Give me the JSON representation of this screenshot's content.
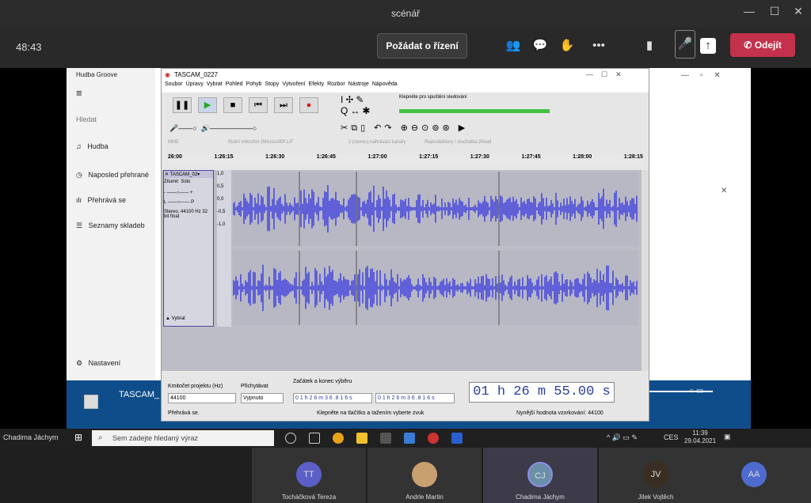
{
  "window": {
    "title": "scénář"
  },
  "meeting": {
    "timer": "48:43",
    "request_control": "Požádat o řízení",
    "leave": "Odejít"
  },
  "groove": {
    "title": "Hudba Groove",
    "search": "Hledat",
    "nav": [
      "Hudba",
      "Naposled přehrané",
      "Přehrává se",
      "Seznamy skladeb"
    ],
    "settings": "Nastavení",
    "now_playing": "TASCAM_"
  },
  "audacity": {
    "title": "TASCAM_0227",
    "menu": [
      "Soubor",
      "Úpravy",
      "Vybrat",
      "Pohled",
      "Pohyb",
      "Stopy",
      "Vytvoření",
      "Efekty",
      "Rozbor",
      "Nástroje",
      "Nápověda"
    ],
    "meter_hint": "Klepněte pro spuštění sledování",
    "host": "MME",
    "input_device": "Stolní mikrofon (Microsoft® LiF",
    "channels": "2 (stereo) nahrávací kanály",
    "output_device": "Reproduktory / sluchátka (Realt",
    "timeline": [
      "26:00",
      "1:26:15",
      "1:26:30",
      "1:26:45",
      "1:27:00",
      "1:27:15",
      "1:27:30",
      "1:27:45",
      "1:28:00",
      "1:28:15"
    ],
    "track": {
      "name": "TASCAM_02",
      "mute": "Ztlumit",
      "solo": "Sólo",
      "L": "L",
      "P": "P",
      "info": "Stereo, 44100 Hz 32 bit float",
      "select": "Vybrat",
      "scale": [
        "1,0",
        "0,5",
        "0,0",
        "-0,5",
        "-1,0"
      ]
    },
    "rate_label": "Kmitočet projektu (Hz)",
    "rate": "44100",
    "snap_label": "Přichytávat",
    "snap": "Vypnuto",
    "sel_label": "Začátek a konec výběru",
    "sel_start": "0 1 h 2 6 m 3 6 .8 1 6 s",
    "sel_end": "0 1 h 2 6 m 3 6 .8 1 6 s",
    "position": "01 h 26 m 55.00 s",
    "status_left": "Přehrává se.",
    "status_mid": "Klepněte na tlačítko a tažením vyberte zvuk",
    "status_right": "Nynější hodnota vzorkování: 44100"
  },
  "taskbar": {
    "user": "Chadima Jáchym",
    "search": "Sem zadejte hledaný výraz",
    "lang": "CES",
    "time": "11:39",
    "date": "29.04.2021"
  },
  "participants": [
    {
      "initials": "TT",
      "name": "Tocháčková Tereza",
      "color": "#5b5fc7"
    },
    {
      "initials": "",
      "name": "Andrle Martin",
      "color": "#c8a070"
    },
    {
      "initials": "CJ",
      "name": "Chadima Jáchym",
      "color": "#6a8fa8"
    },
    {
      "initials": "JV",
      "name": "Jílek Vojtěch",
      "color": "#3a2e22"
    },
    {
      "initials": "AA",
      "name": "",
      "color": "#4f6bd0"
    }
  ]
}
